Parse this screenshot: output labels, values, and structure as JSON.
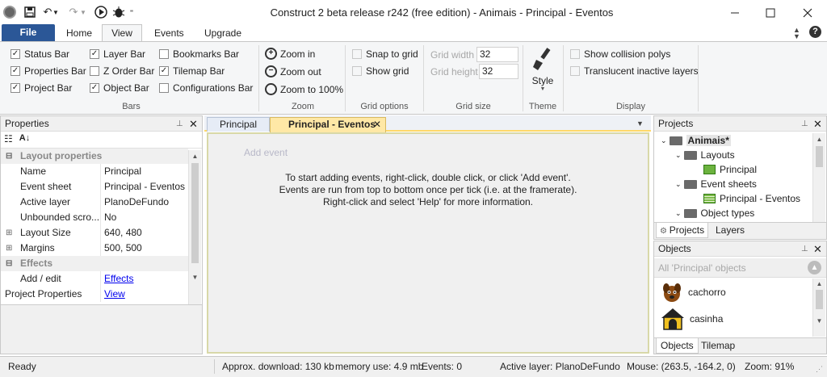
{
  "window": {
    "title": "Construct 2 beta release r242  (free edition) - Animais - Principal - Eventos",
    "minimize_icon": "minimize-icon",
    "maximize_icon": "maximize-icon",
    "close_icon": "close-icon"
  },
  "ribbon": {
    "tabs": [
      {
        "label": "File"
      },
      {
        "label": "Home"
      },
      {
        "label": "View"
      },
      {
        "label": "Events"
      },
      {
        "label": "Upgrade"
      }
    ],
    "bars": {
      "items": [
        {
          "label": "Status Bar",
          "checked": true
        },
        {
          "label": "Properties Bar",
          "checked": true
        },
        {
          "label": "Project Bar",
          "checked": true
        },
        {
          "label": "Layer Bar",
          "checked": true
        },
        {
          "label": "Z Order Bar",
          "checked": false
        },
        {
          "label": "Object Bar",
          "checked": true
        },
        {
          "label": "Bookmarks Bar",
          "checked": false
        },
        {
          "label": "Tilemap Bar",
          "checked": true
        },
        {
          "label": "Configurations Bar",
          "checked": false
        }
      ],
      "group_label": "Bars"
    },
    "zoom": {
      "zoom_in": "Zoom in",
      "zoom_out": "Zoom out",
      "zoom_100": "Zoom to 100%",
      "group_label": "Zoom"
    },
    "grid_options": {
      "snap": "Snap to grid",
      "show": "Show grid",
      "group_label": "Grid options"
    },
    "grid_size": {
      "width_label": "Grid width",
      "width_value": "32",
      "height_label": "Grid height",
      "height_value": "32",
      "group_label": "Grid size"
    },
    "theme": {
      "style_label": "Style",
      "group_label": "Theme"
    },
    "display": {
      "collision": "Show collision polys",
      "translucent": "Translucent inactive layers",
      "group_label": "Display"
    }
  },
  "properties": {
    "title": "Properties",
    "rows": [
      {
        "key": "Layout properties",
        "value": "",
        "category": true
      },
      {
        "key": "Name",
        "value": "Principal"
      },
      {
        "key": "Event sheet",
        "value": "Principal - Eventos"
      },
      {
        "key": "Active layer",
        "value": "PlanoDeFundo"
      },
      {
        "key": "Unbounded scro...",
        "value": "No"
      },
      {
        "key": "Layout Size",
        "value": "640, 480",
        "expand": true
      },
      {
        "key": "Margins",
        "value": "500, 500",
        "expand": true
      },
      {
        "key": "Effects",
        "value": "",
        "category": true
      },
      {
        "key": "Add / edit",
        "value": "Effects",
        "link": true
      },
      {
        "key": "Project Properties",
        "value": "View",
        "link": true,
        "root": true
      }
    ]
  },
  "editor": {
    "tabs": [
      {
        "label": "Principal"
      },
      {
        "label": "Principal - Eventos"
      }
    ],
    "add_event": "Add event",
    "hints": [
      "To start adding events, right-click, double click, or click 'Add event'.",
      "Events are run from top to bottom once per tick (i.e. at the framerate).",
      "Right-click and select 'Help' for more information."
    ]
  },
  "projects": {
    "title": "Projects",
    "tree": [
      {
        "label": "Animais*",
        "level": 0,
        "icon": "folder-icon",
        "bold": true
      },
      {
        "label": "Layouts",
        "level": 1,
        "icon": "folder-icon"
      },
      {
        "label": "Principal",
        "level": 2,
        "icon": "layout-icon"
      },
      {
        "label": "Event sheets",
        "level": 1,
        "icon": "folder-icon"
      },
      {
        "label": "Principal - Eventos",
        "level": 2,
        "icon": "event-sheet-icon"
      },
      {
        "label": "Object types",
        "level": 1,
        "icon": "folder-icon"
      }
    ],
    "tabs": [
      {
        "label": "Projects"
      },
      {
        "label": "Layers"
      }
    ]
  },
  "objects": {
    "title": "Objects",
    "filter_placeholder": "All 'Principal' objects",
    "items": [
      {
        "label": "cachorro",
        "icon": "dog-icon"
      },
      {
        "label": "casinha",
        "icon": "doghouse-icon"
      }
    ],
    "tabs": [
      {
        "label": "Objects"
      },
      {
        "label": "Tilemap"
      }
    ]
  },
  "statusbar": {
    "ready": "Ready",
    "download": "Approx. download: 130 kb",
    "memory": "memory use: 4.9 mb",
    "events": "Events: 0",
    "active_layer": "Active layer: PlanoDeFundo",
    "mouse": "Mouse: (263.5, -164.2, 0)",
    "zoom": "Zoom: 91%"
  },
  "colors": {
    "file_tab": "#2b5797",
    "active_doc_tab": "#ffe8a6",
    "ribbon_bg": "#f5f6f7",
    "editor_border": "#c9c9a0"
  }
}
